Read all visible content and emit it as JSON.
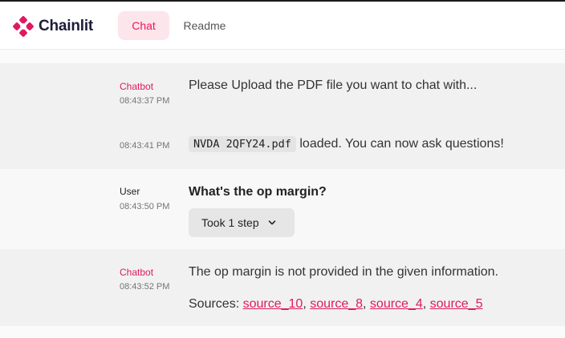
{
  "app": {
    "name": "Chainlit"
  },
  "colors": {
    "accent": "#e0195f",
    "tab_active_bg": "#fde5ec"
  },
  "tabs": [
    {
      "label": "Chat",
      "active": true
    },
    {
      "label": "Readme",
      "active": false
    }
  ],
  "messages": [
    {
      "author": "Chatbot",
      "time": "08:43:37 PM",
      "text": "Please Upload the PDF file you want to chat with..."
    },
    {
      "author": "",
      "time": "08:43:41 PM",
      "filename": "NVDA 2QFY24.pdf",
      "text": "loaded. You can now ask questions!"
    },
    {
      "author": "User",
      "time": "08:43:50 PM",
      "text": "What's the op margin?",
      "step_label": "Took 1 step"
    },
    {
      "author": "Chatbot",
      "time": "08:43:52 PM",
      "text": "The op margin is not provided in the given information.",
      "sources_label": "Sources:",
      "sources": [
        "source_10",
        "source_8",
        "source_4",
        "source_5"
      ]
    }
  ]
}
